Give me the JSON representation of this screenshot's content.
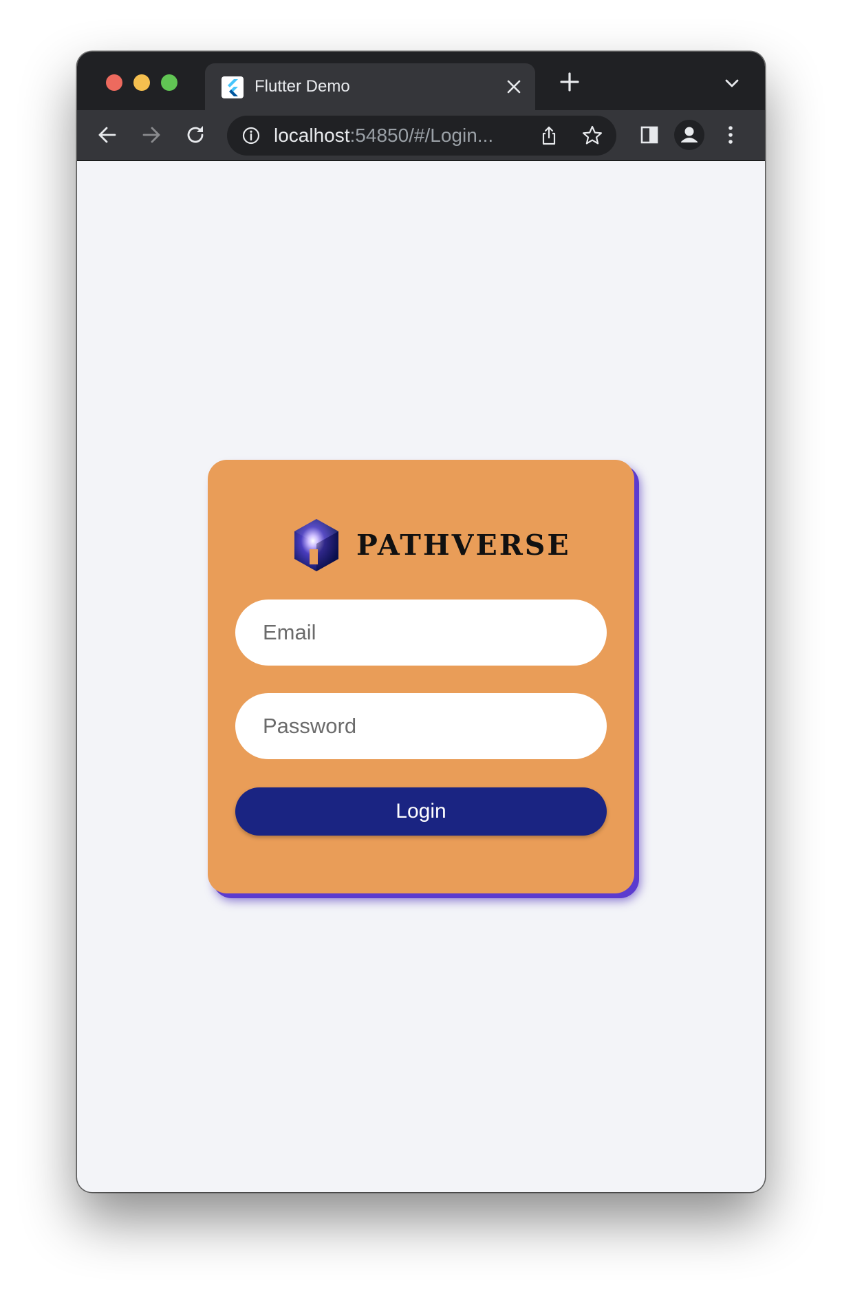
{
  "browser": {
    "tab_title": "Flutter Demo",
    "url_host": "localhost",
    "url_rest": ":54850/#/Login...",
    "colors": {
      "titlebar": "#202124",
      "toolbar": "#35363a",
      "close_dot": "#ed6a5e",
      "minimize_dot": "#f5bf4f",
      "zoom_dot": "#61c554"
    }
  },
  "login": {
    "brand_name": "PATHVERSE",
    "email_placeholder": "Email",
    "password_placeholder": "Password",
    "login_label": "Login",
    "colors": {
      "card": "#e99d58",
      "card_shadow": "#5b3bcf",
      "button": "#1a2482",
      "page_background": "#f3f4f8"
    }
  },
  "icons": {
    "tab_favicon": "flutter-logo-icon",
    "tab_close": "close-icon",
    "new_tab": "plus-icon",
    "tab_list": "chevron-down-icon",
    "back": "arrow-left-icon",
    "forward": "arrow-right-icon",
    "reload": "reload-icon",
    "site_info": "info-icon",
    "share": "share-icon",
    "bookmark": "star-icon",
    "side_panel": "side-panel-icon",
    "profile": "profile-icon",
    "menu": "kebab-menu-icon",
    "brand_logo": "pathverse-cube-logo"
  }
}
